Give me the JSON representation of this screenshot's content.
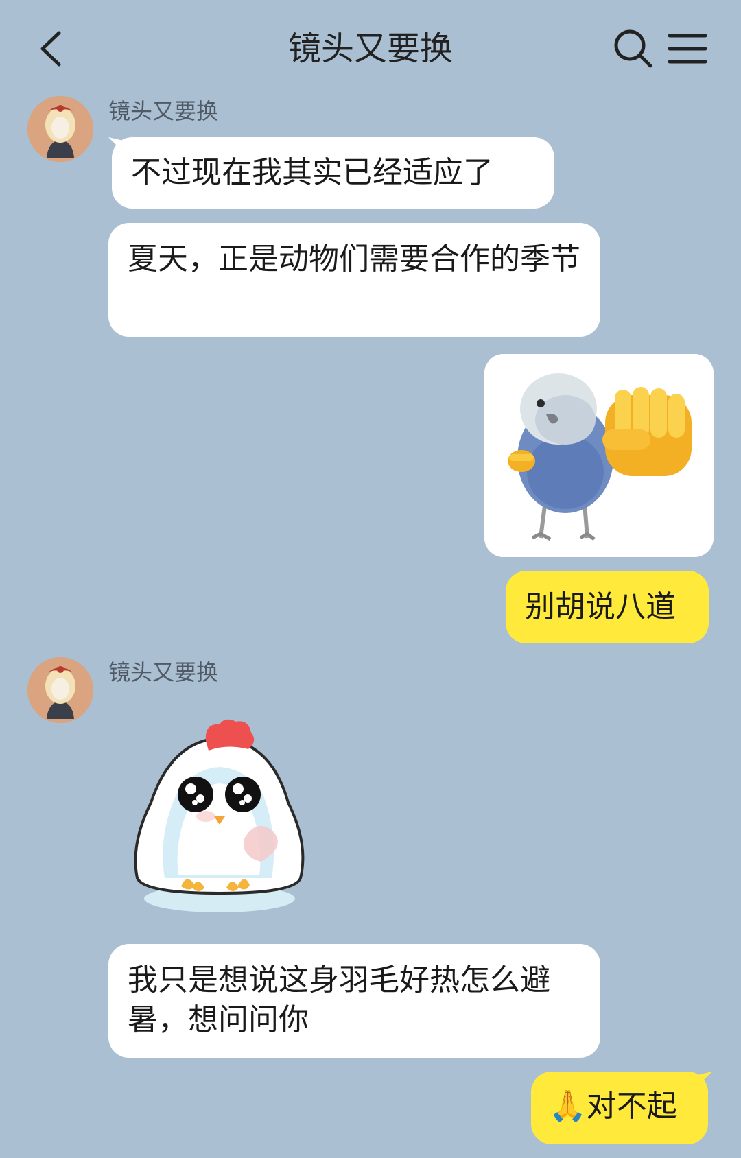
{
  "header": {
    "title": "镜头又要换",
    "back_icon": "chevron-left-icon",
    "search_icon": "search-icon",
    "menu_icon": "menu-icon"
  },
  "messages": [
    {
      "sender": "镜头又要换",
      "text": "不过现在我其实已经适应了"
    },
    {
      "text": "夏天，正是动物们需要合作的季节"
    },
    {
      "sticker": "parrot-punch-sticker"
    },
    {
      "text": "别胡说八道"
    },
    {
      "sender": "镜头又要换",
      "sticker": "white-chick-sticker"
    },
    {
      "text": "我只是想说这身羽毛好热怎么避暑，想问问你"
    },
    {
      "emoji": "🙏",
      "text": "对不起"
    }
  ],
  "colors": {
    "background": "#AABFD2",
    "incoming_bubble": "#FFFFFF",
    "outgoing_bubble": "#FFE93A"
  }
}
